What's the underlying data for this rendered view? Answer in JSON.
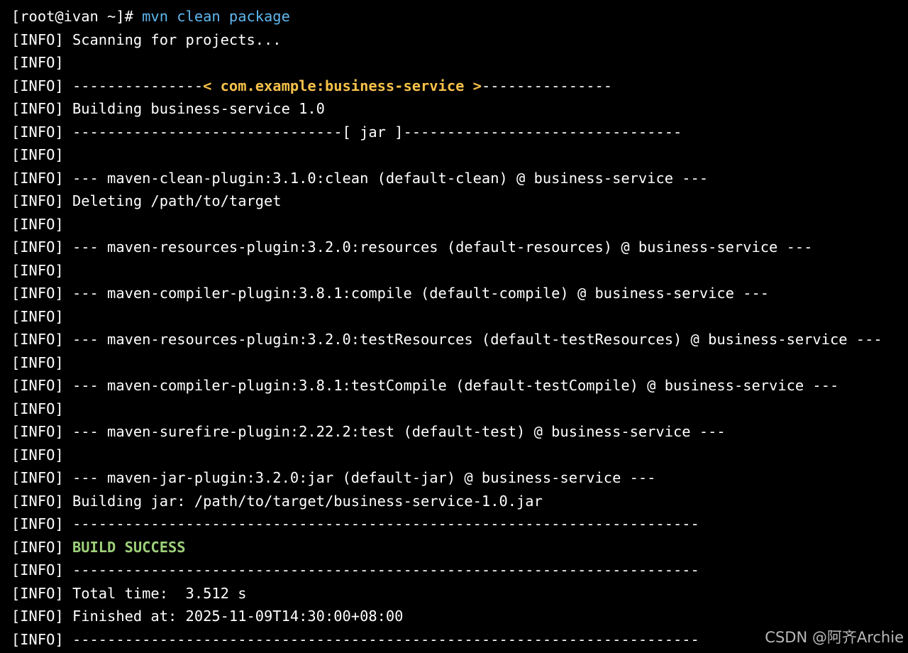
{
  "terminal": {
    "prompt": "[root@ivan ~]# ",
    "command": "mvn clean package",
    "info_prefix": "[INFO]",
    "lines": [
      " Scanning for projects...",
      "",
      null,
      " Building business-service 1.0",
      " -------------------------------[ jar ]--------------------------------",
      "",
      " --- maven-clean-plugin:3.1.0:clean (default-clean) @ business-service ---",
      " Deleting /path/to/target",
      "",
      " --- maven-resources-plugin:3.2.0:resources (default-resources) @ business-service ---",
      "",
      " --- maven-compiler-plugin:3.8.1:compile (default-compile) @ business-service ---",
      "",
      " --- maven-resources-plugin:3.2.0:testResources (default-testResources) @ business-service ---",
      "",
      " --- maven-compiler-plugin:3.8.1:testCompile (default-testCompile) @ business-service ---",
      "",
      " --- maven-surefire-plugin:2.22.2:test (default-test) @ business-service ---",
      "",
      " --- maven-jar-plugin:3.2.0:jar (default-jar) @ business-service ---",
      " Building jar: /path/to/target/business-service-1.0.jar",
      " ------------------------------------------------------------------------",
      null,
      " ------------------------------------------------------------------------",
      " Total time:  3.512 s",
      " Finished at: 2025-11-09T14:30:00+08:00",
      " ------------------------------------------------------------------------"
    ],
    "artifact_line": {
      "left_dashes": " ---------------",
      "artifact": "< com.example:business-service >",
      "right_dashes": "---------------"
    },
    "build_status": " BUILD SUCCESS"
  },
  "watermark": "CSDN @阿齐Archie",
  "colors": {
    "background": "#000000",
    "text": "#ffffff",
    "command": "#5fb7ef",
    "artifact": "#f7c14a",
    "success": "#9ed07a",
    "watermark": "#b9b9b9"
  }
}
